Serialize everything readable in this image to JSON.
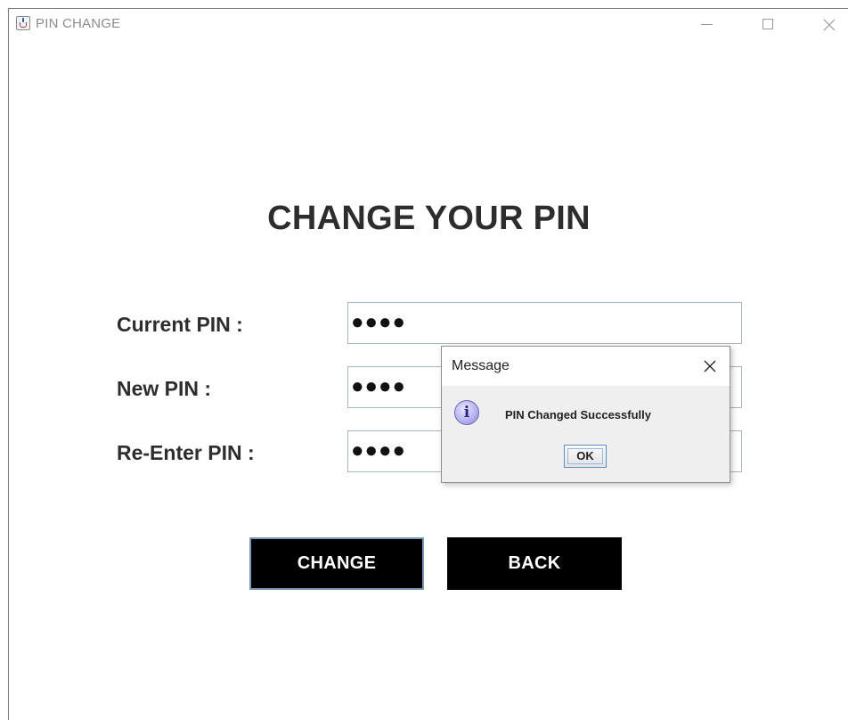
{
  "window": {
    "title": "PIN CHANGE",
    "app_icon": "java-cup-icon"
  },
  "form": {
    "heading": "CHANGE YOUR PIN",
    "current_pin_label": "Current PIN :",
    "new_pin_label": "New PIN :",
    "reenter_pin_label": "Re-Enter PIN :",
    "current_pin_value": "●●●●",
    "new_pin_value": "●●●●",
    "reenter_pin_value": "●●●●",
    "change_label": "CHANGE",
    "back_label": "BACK"
  },
  "dialog": {
    "title": "Message",
    "message": "PIN Changed Successfully",
    "ok_label": "OK",
    "icon": "info-icon"
  },
  "colors": {
    "button_bg": "#000000",
    "button_text": "#ffffff",
    "heading_text": "#2d2d2d",
    "focus_border": "#7d97b8"
  }
}
